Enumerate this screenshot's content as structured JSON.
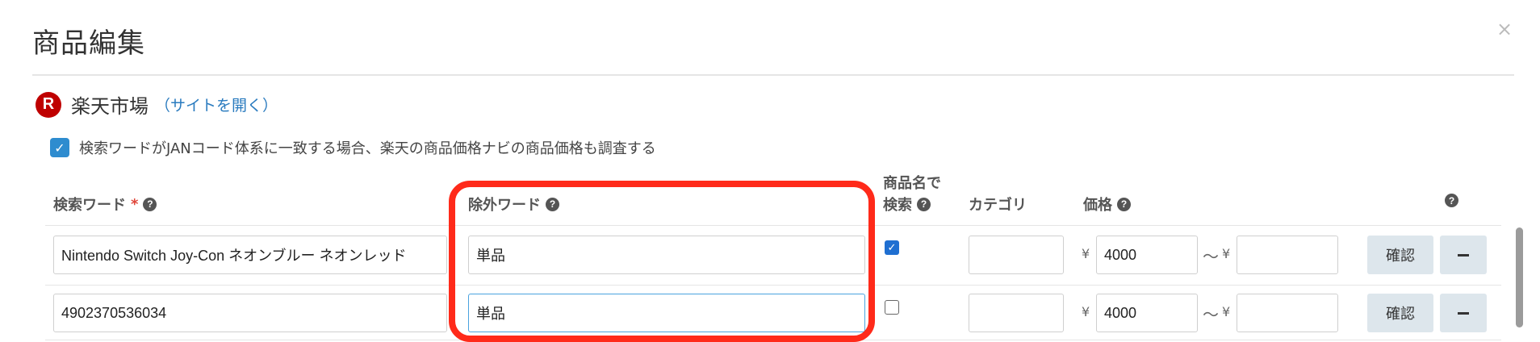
{
  "modal": {
    "title": "商品編集",
    "close": "×"
  },
  "shop": {
    "logo": "R",
    "name": "楽天市場",
    "link": "（サイトを開く）"
  },
  "option": {
    "checked": true,
    "label": "検索ワードがJANコード体系に一致する場合、楽天の商品価格ナビの商品価格も調査する"
  },
  "columns": {
    "search_word": "検索ワード",
    "required_mark": "*",
    "exclude_word": "除外ワード",
    "name_search_line1": "商品名で",
    "name_search_line2": "検索",
    "category": "カテゴリ",
    "price": "価格",
    "help": "?"
  },
  "rows": [
    {
      "search_word": "Nintendo Switch Joy-Con ネオンブルー ネオンレッド",
      "exclude_word": "単品",
      "name_search": true,
      "category": "",
      "price_currency": "¥",
      "price_min": "4000",
      "range_sep": "〜",
      "price_max": "",
      "confirm_label": "確認"
    },
    {
      "search_word": "4902370536034",
      "exclude_word": "単品",
      "name_search": false,
      "category": "",
      "price_currency": "¥",
      "price_min": "4000",
      "range_sep": "〜",
      "price_max": "",
      "confirm_label": "確認"
    }
  ],
  "icons": {
    "close": "close-icon",
    "help": "question-circle-icon",
    "remove": "minus-icon",
    "check": "check-icon"
  },
  "colors": {
    "accent": "#2e8ccf",
    "link": "#2a7bbf",
    "brand": "#bf0000",
    "highlight": "#ff2a1a",
    "required": "#e0463a"
  }
}
